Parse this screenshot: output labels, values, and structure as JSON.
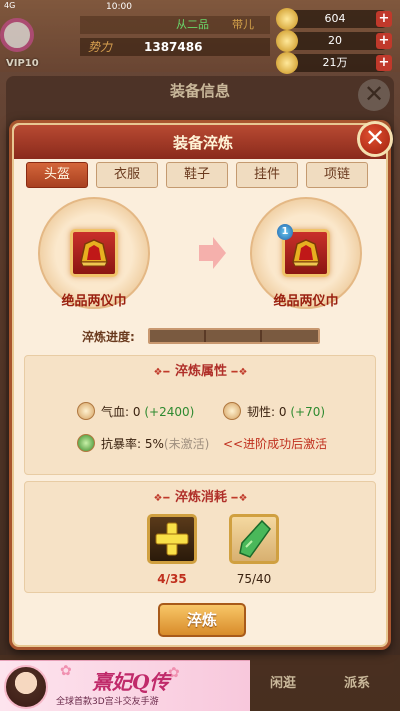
{
  "status_bar": {
    "signal": "4G",
    "time": "10:00"
  },
  "top_bar": {
    "vip": "VIP10",
    "rank": "从二品",
    "title": "带儿",
    "power_label": "势力",
    "power_value": "1387486",
    "resources": [
      {
        "icon": "coin-icon",
        "value": "604"
      },
      {
        "icon": "ingot-icon",
        "value": "20"
      },
      {
        "icon": "silver-icon",
        "value": "21万"
      }
    ]
  },
  "outer_panel": {
    "title": "装备信息"
  },
  "modal": {
    "title": "装备淬炼",
    "tabs": [
      "头盔",
      "衣服",
      "鞋子",
      "挂件",
      "项链"
    ],
    "active_tab": 0,
    "current_item": {
      "name": "绝品两仪巾"
    },
    "next_item": {
      "name": "绝品两仪巾",
      "level": "1"
    },
    "progress_label": "淬炼进度:",
    "progress": 0,
    "attributes_title": "淬炼属性",
    "attributes": [
      {
        "icon": "heart-icon",
        "label": "气血:",
        "value": "0",
        "bonus": "(+2400)"
      },
      {
        "icon": "heart-icon",
        "label": "韧性:",
        "value": "0",
        "bonus": "(+70)"
      }
    ],
    "crit_resist": {
      "label": "抗暴率:",
      "value": "5%",
      "status": "(未激活)",
      "note": "<<进阶成功后激活"
    },
    "cost_title": "淬炼消耗",
    "costs": [
      {
        "icon": "plus-stone-icon",
        "amount": "4/35",
        "color": "#c0301e"
      },
      {
        "icon": "jade-icon",
        "amount": "75/40",
        "color": "#3a2210"
      }
    ],
    "button_label": "淬炼"
  },
  "bottom_nav": {
    "items": [
      "闲逛",
      "派系"
    ]
  },
  "ad": {
    "logo": "熹妃Q传",
    "subtitle": "全球首款3D宫斗交友手游"
  },
  "colors": {
    "accent": "#a8552e",
    "header": "#9a3220",
    "progress_fill": "#e0b050"
  }
}
